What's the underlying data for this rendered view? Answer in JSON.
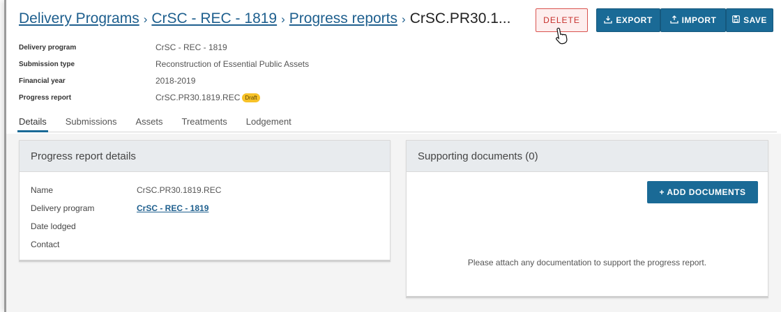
{
  "breadcrumb": {
    "items": [
      "Delivery Programs",
      "CrSC - REC - 1819",
      "Progress reports"
    ],
    "current": "CrSC.PR30.1...",
    "separator": "›"
  },
  "toolbar": {
    "delete_label": "DELETE",
    "export_label": "EXPORT",
    "import_label": "IMPORT",
    "save_label": "SAVE"
  },
  "meta": [
    {
      "label": "Delivery program",
      "value": "CrSC - REC - 1819"
    },
    {
      "label": "Submission type",
      "value": "Reconstruction of Essential Public Assets"
    },
    {
      "label": "Financial year",
      "value": "2018-2019"
    },
    {
      "label": "Progress report",
      "value": "CrSC.PR30.1819.REC",
      "badge": "Draft"
    }
  ],
  "tabs": [
    "Details",
    "Submissions",
    "Assets",
    "Treatments",
    "Lodgement"
  ],
  "details_panel": {
    "title": "Progress report details",
    "rows": [
      {
        "label": "Name",
        "value": "CrSC.PR30.1819.REC"
      },
      {
        "label": "Delivery program",
        "value": "CrSC - REC - 1819"
      },
      {
        "label": "Date lodged",
        "value": ""
      },
      {
        "label": "Contact",
        "value": ""
      }
    ]
  },
  "documents_panel": {
    "title": "Supporting documents (0)",
    "add_label": "+ ADD DOCUMENTS",
    "empty_message": "Please attach any documentation to support the progress report."
  },
  "colors": {
    "primary": "#1a6a96",
    "danger": "#c62f2b",
    "badge": "#f7c228"
  },
  "icons": {
    "export": "export-icon",
    "import": "import-icon",
    "save": "save-icon",
    "cursor": "hand-pointer-icon"
  }
}
